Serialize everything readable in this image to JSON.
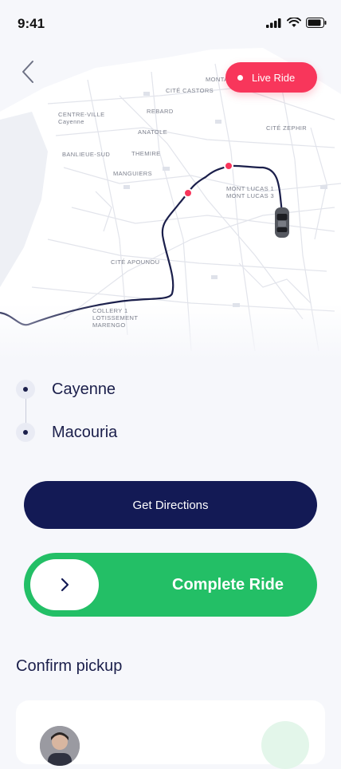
{
  "status_bar": {
    "time": "9:41"
  },
  "header": {
    "live_ride_label": "Live Ride"
  },
  "map": {
    "labels": {
      "montabo": "MONTABO",
      "cite_castors": "CITÉ CASTORS",
      "centre_ville": "CENTRE-VILLE\nCayenne",
      "rebard": "REBARD",
      "anatole": "ANATOLE",
      "cite_zephir": "CITÉ ZEPHIR",
      "banlieue_sud": "BANLIEUE-SUD",
      "themire": "THEMIRE",
      "manguiers": "MANGUIERS",
      "mont_lucas": "MONT LUCAS 1\nMONT LUCAS 3",
      "cite_apounou": "CITÉ APOUNOU",
      "collery": "COLLERY 1\nLOTISSEMENT\nMARENGO"
    },
    "colors": {
      "route": "#1b1f4b",
      "marker": "#f8365b"
    }
  },
  "route": {
    "pickup": "Cayenne",
    "dropoff": "Macouria"
  },
  "actions": {
    "directions_label": "Get Directions",
    "complete_label": "Complete Ride"
  },
  "pickup_section": {
    "title": "Confirm pickup"
  },
  "colors": {
    "primary": "#131a55",
    "accent_red": "#f8365b",
    "success": "#23bf66"
  }
}
